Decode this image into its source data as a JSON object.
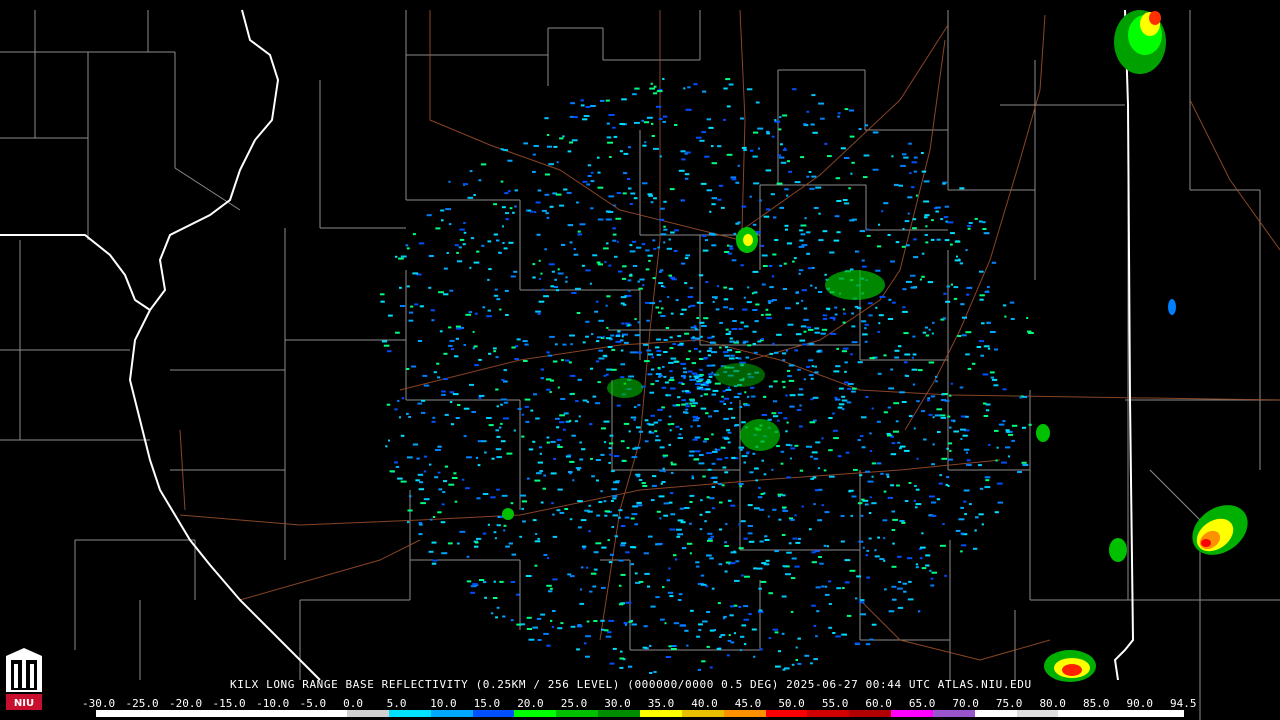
{
  "caption": "KILX LONG RANGE BASE REFLECTIVITY (0.25KM / 256 LEVEL) (000000/0000 0.5 DEG) 2025-06-27 00:44 UTC  ATLAS.NIU.EDU",
  "logo_text": "NIU",
  "scale": {
    "labels": [
      "-30.0",
      "-25.0",
      "-20.0",
      "-15.0",
      "-10.0",
      "-5.0",
      "0.0",
      "5.0",
      "10.0",
      "15.0",
      "20.0",
      "25.0",
      "30.0",
      "35.0",
      "40.0",
      "45.0",
      "50.0",
      "55.0",
      "60.0",
      "65.0",
      "70.0",
      "75.0",
      "80.0",
      "85.0",
      "90.0",
      "94.5"
    ],
    "colors": [
      "#ffffff",
      "#ffffff",
      "#ffffff",
      "#ffffff",
      "#ffffff",
      "#ffffff",
      "#d0d0d0",
      "#00e0ff",
      "#00a8ff",
      "#0050ff",
      "#00ff00",
      "#00c000",
      "#008c00",
      "#ffff00",
      "#e8c000",
      "#ff9000",
      "#ff0000",
      "#d00000",
      "#b00000",
      "#ff00ff",
      "#9955cc",
      "#ffffff",
      "#e0e0e0",
      "#ffffff",
      "#ffffff",
      "#ffffff"
    ]
  },
  "colors": {
    "background": "#000000",
    "county_lines": "#8c8c8c",
    "state_lines": "#ffffff",
    "roads": "#a0522d"
  }
}
